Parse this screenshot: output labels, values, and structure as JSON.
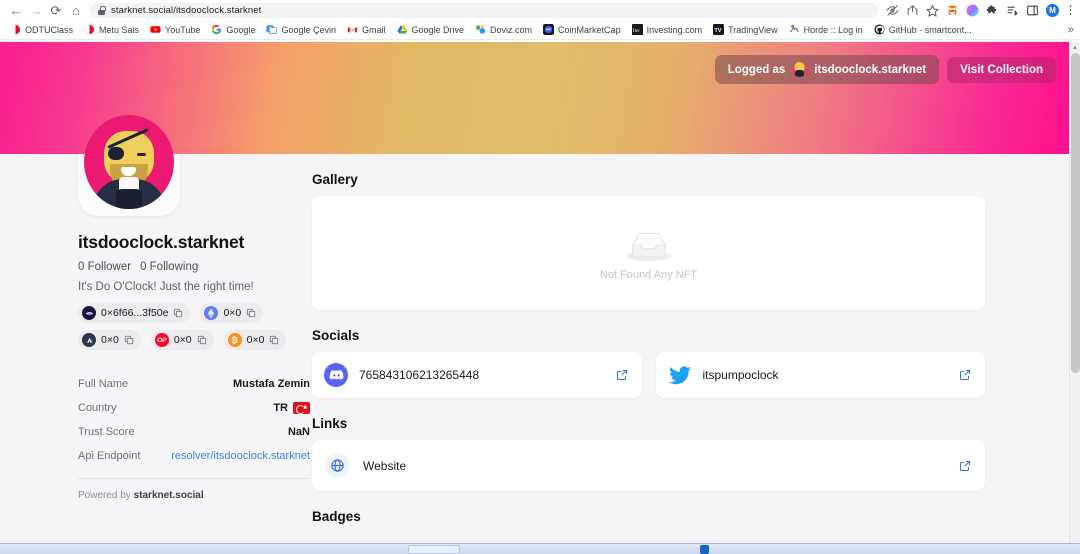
{
  "browser": {
    "url": "starknet.social/itsdooclock.starknet",
    "nav": {
      "back": "←",
      "forward": "→",
      "reload": "⟳",
      "home": "⌂"
    },
    "toolbar_icons": [
      "eye-off-icon",
      "share-icon",
      "star-icon",
      "metamask-icon",
      "colorful-extension-icon",
      "puzzle-extension-icon",
      "reading-list-icon",
      "side-panel-icon",
      "profile-avatar",
      "kebab-menu-icon"
    ],
    "profile_initial": "M",
    "bookmarks": [
      {
        "label": "ODTUClass",
        "icon": "odtuclass-icon"
      },
      {
        "label": "Metu Sais",
        "icon": "metusais-icon"
      },
      {
        "label": "YouTube",
        "icon": "youtube-icon"
      },
      {
        "label": "Google",
        "icon": "google-icon"
      },
      {
        "label": "Google Çeviri",
        "icon": "google-translate-icon"
      },
      {
        "label": "Gmail",
        "icon": "gmail-icon"
      },
      {
        "label": "Google Drive",
        "icon": "google-drive-icon"
      },
      {
        "label": "Doviz.com",
        "icon": "doviz-icon"
      },
      {
        "label": "CoinMarketCap",
        "icon": "coinmarketcap-icon"
      },
      {
        "label": "Investing.com",
        "icon": "investing-icon"
      },
      {
        "label": "TradingView",
        "icon": "tradingview-icon"
      },
      {
        "label": "Horde :: Log in",
        "icon": "horde-icon"
      },
      {
        "label": "GitHub - smartcont...",
        "icon": "github-icon"
      }
    ],
    "bookmarks_overflow": "»"
  },
  "banner": {
    "logged_as_prefix": "Logged as",
    "logged_as_name": "itsdooclock.starknet",
    "visit_collection": "Visit Collection",
    "gradient_start": "#fa1e8e",
    "gradient_mid": "#dfbd6b",
    "gradient_end": "#fc0f8d"
  },
  "profile": {
    "display_name": "itsdooclock.starknet",
    "followers": "0 Follower",
    "following": "0 Following",
    "bio": "It's Do O'Clock! Just the right time!",
    "chips": [
      {
        "icon": "starknet-icon",
        "value": "0×6f66...3f50e"
      },
      {
        "icon": "ethereum-icon",
        "value": "0×0"
      },
      {
        "icon": "arbitrum-icon",
        "value": "0×0"
      },
      {
        "icon": "optimism-icon",
        "value": "0×0"
      },
      {
        "icon": "bitcoin-icon",
        "value": "0×0"
      }
    ],
    "info": [
      {
        "label": "Full Name",
        "value": "Mustafa Zemin",
        "type": "text"
      },
      {
        "label": "Country",
        "value": "TR",
        "type": "country"
      },
      {
        "label": "Trust Score",
        "value": "NaN",
        "type": "text"
      },
      {
        "label": "Api Endpoint",
        "value": "resolver/itsdooclock.starknet",
        "type": "link"
      }
    ],
    "powered_prefix": "Powered by",
    "powered_brand": "starknet.social"
  },
  "main": {
    "gallery_title": "Gallery",
    "gallery_empty_text": "Not Found Any NFT",
    "socials_title": "Socials",
    "socials": [
      {
        "icon": "discord-icon",
        "label": "765843106213265448"
      },
      {
        "icon": "twitter-icon",
        "label": "itspumpoclock"
      }
    ],
    "links_title": "Links",
    "links": [
      {
        "icon": "globe-icon",
        "label": "Website"
      }
    ],
    "badges_title": "Badges"
  }
}
